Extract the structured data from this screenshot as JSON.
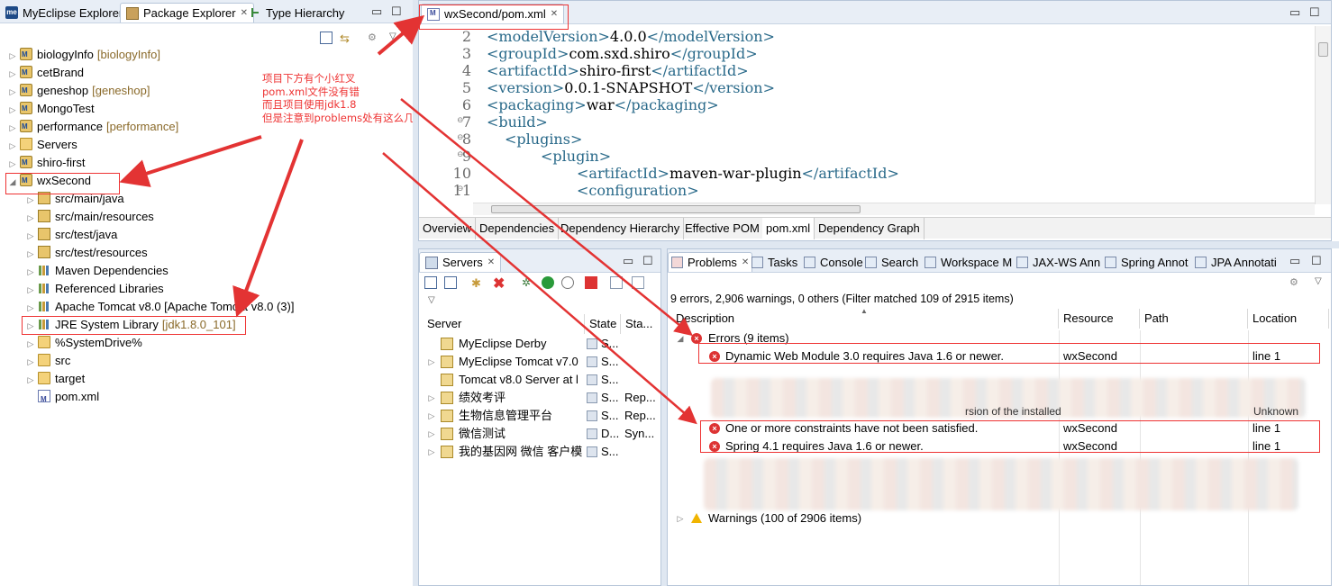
{
  "left_panel": {
    "tabs": [
      {
        "label": "MyEclipse Explorer"
      },
      {
        "label": "Package Explorer"
      },
      {
        "label": "Type Hierarchy"
      }
    ],
    "tree": [
      {
        "label": "biologyInfo",
        "deco": "[biologyInfo]",
        "icon": "maven-project-icon"
      },
      {
        "label": "cetBrand",
        "deco": "",
        "icon": "maven-project-icon"
      },
      {
        "label": "geneshop",
        "deco": "[geneshop]",
        "icon": "maven-project-icon"
      },
      {
        "label": "MongoTest",
        "deco": "",
        "icon": "project-icon"
      },
      {
        "label": "performance",
        "deco": "[performance]",
        "icon": "maven-project-icon"
      },
      {
        "label": "Servers",
        "deco": "",
        "icon": "folder-icon"
      },
      {
        "label": "shiro-first",
        "deco": "",
        "icon": "maven-project-icon"
      },
      {
        "label": "wxSecond",
        "deco": "",
        "icon": "maven-project-icon"
      },
      {
        "label": "src/main/java",
        "deco": "",
        "icon": "source-folder-icon"
      },
      {
        "label": "src/main/resources",
        "deco": "",
        "icon": "source-folder-icon"
      },
      {
        "label": "src/test/java",
        "deco": "",
        "icon": "source-folder-icon"
      },
      {
        "label": "src/test/resources",
        "deco": "",
        "icon": "source-folder-icon"
      },
      {
        "label": "Maven Dependencies",
        "deco": "",
        "icon": "library-icon"
      },
      {
        "label": "Referenced Libraries",
        "deco": "",
        "icon": "library-icon"
      },
      {
        "label": "Apache Tomcat v8.0 [Apache Tomcat v8.0 (3)]",
        "deco": "",
        "icon": "library-icon"
      },
      {
        "label": "JRE System Library",
        "deco": "[jdk1.8.0_101]",
        "icon": "library-icon"
      },
      {
        "label": "%SystemDrive%",
        "deco": "",
        "icon": "folder-icon"
      },
      {
        "label": "src",
        "deco": "",
        "icon": "folder-icon"
      },
      {
        "label": "target",
        "deco": "",
        "icon": "folder-icon"
      },
      {
        "label": "pom.xml",
        "deco": "",
        "icon": "xml-file-icon"
      }
    ]
  },
  "annotation": [
    "项目下方有个小红叉",
    "pom.xml文件没有错",
    "而且项目使用jdk1.8",
    "但是注意到problems处有这么几个问题"
  ],
  "editor": {
    "tab_label": "wxSecond/pom.xml",
    "lines": [
      {
        "n": "2",
        "tag_open": "<modelVersion>",
        "text": "4.0.0",
        "tag_close": "</modelVersion>"
      },
      {
        "n": "3",
        "tag_open": "<groupId>",
        "text": "com.sxd.shiro",
        "tag_close": "</groupId>"
      },
      {
        "n": "4",
        "tag_open": "<artifactId>",
        "text": "shiro-first",
        "tag_close": "</artifactId>"
      },
      {
        "n": "5",
        "tag_open": "<version>",
        "text": "0.0.1-SNAPSHOT",
        "tag_close": "</version>"
      },
      {
        "n": "6",
        "tag_open": "<packaging>",
        "text": "war",
        "tag_close": "</packaging>"
      },
      {
        "n": "7",
        "tag_open": "<build>",
        "text": "",
        "tag_close": ""
      },
      {
        "n": "8",
        "tag_open": "<plugins>",
        "text": "",
        "tag_close": ""
      },
      {
        "n": "9",
        "tag_open": "<plugin>",
        "text": "",
        "tag_close": ""
      },
      {
        "n": "10",
        "tag_open": "<artifactId>",
        "text": "maven-war-plugin",
        "tag_close": "</artifactId>"
      },
      {
        "n": "11",
        "tag_open": "<configuration>",
        "text": "",
        "tag_close": ""
      }
    ],
    "bottom_tabs": [
      "Overview",
      "Dependencies",
      "Dependency Hierarchy",
      "Effective POM",
      "pom.xml",
      "Dependency Graph"
    ]
  },
  "servers_panel": {
    "tab_label": "Servers",
    "columns": [
      "Server",
      "State",
      "Sta..."
    ],
    "rows": [
      {
        "name": "MyEclipse Derby",
        "state": "S...",
        "status": ""
      },
      {
        "name": "MyEclipse Tomcat v7.0",
        "state": "S...",
        "status": ""
      },
      {
        "name": "Tomcat v8.0 Server at l",
        "state": "S...",
        "status": ""
      },
      {
        "name": "绩效考评",
        "state": "S...",
        "status": "Rep..."
      },
      {
        "name": "生物信息管理平台",
        "state": "S...",
        "status": "Rep..."
      },
      {
        "name": "微信测试",
        "state": "D...",
        "status": "Syn..."
      },
      {
        "name": "我的基因网  微信 客户模",
        "state": "S...",
        "status": ""
      }
    ]
  },
  "problems_panel": {
    "tabs": [
      "Problems",
      "Tasks",
      "Console",
      "Search",
      "Workspace M",
      "JAX-WS Ann",
      "Spring Annot",
      "JPA Annotati"
    ],
    "summary": "9 errors, 2,906 warnings, 0 others (Filter matched 109 of 2915 items)",
    "columns": [
      "Description",
      "Resource",
      "Path",
      "Location"
    ],
    "errors_group": "Errors (9 items)",
    "errors": [
      {
        "desc": "Dynamic Web Module 3.0 requires Java 1.6 or newer.",
        "resource": "wxSecond",
        "path": "",
        "location": "line 1"
      },
      {
        "desc": "One or more constraints have not been satisfied.",
        "resource": "wxSecond",
        "path": "",
        "location": "line 1"
      },
      {
        "desc": "Spring 4.1 requires Java 1.6 or newer.",
        "resource": "wxSecond",
        "path": "",
        "location": "line 1"
      }
    ],
    "partial_text": "rsion of the installed",
    "partial_loc": "Unknown",
    "warnings_group": "Warnings (100 of 2906 items)"
  },
  "colors": {
    "accent": "#e33333",
    "tag": "#2a6a8a"
  }
}
